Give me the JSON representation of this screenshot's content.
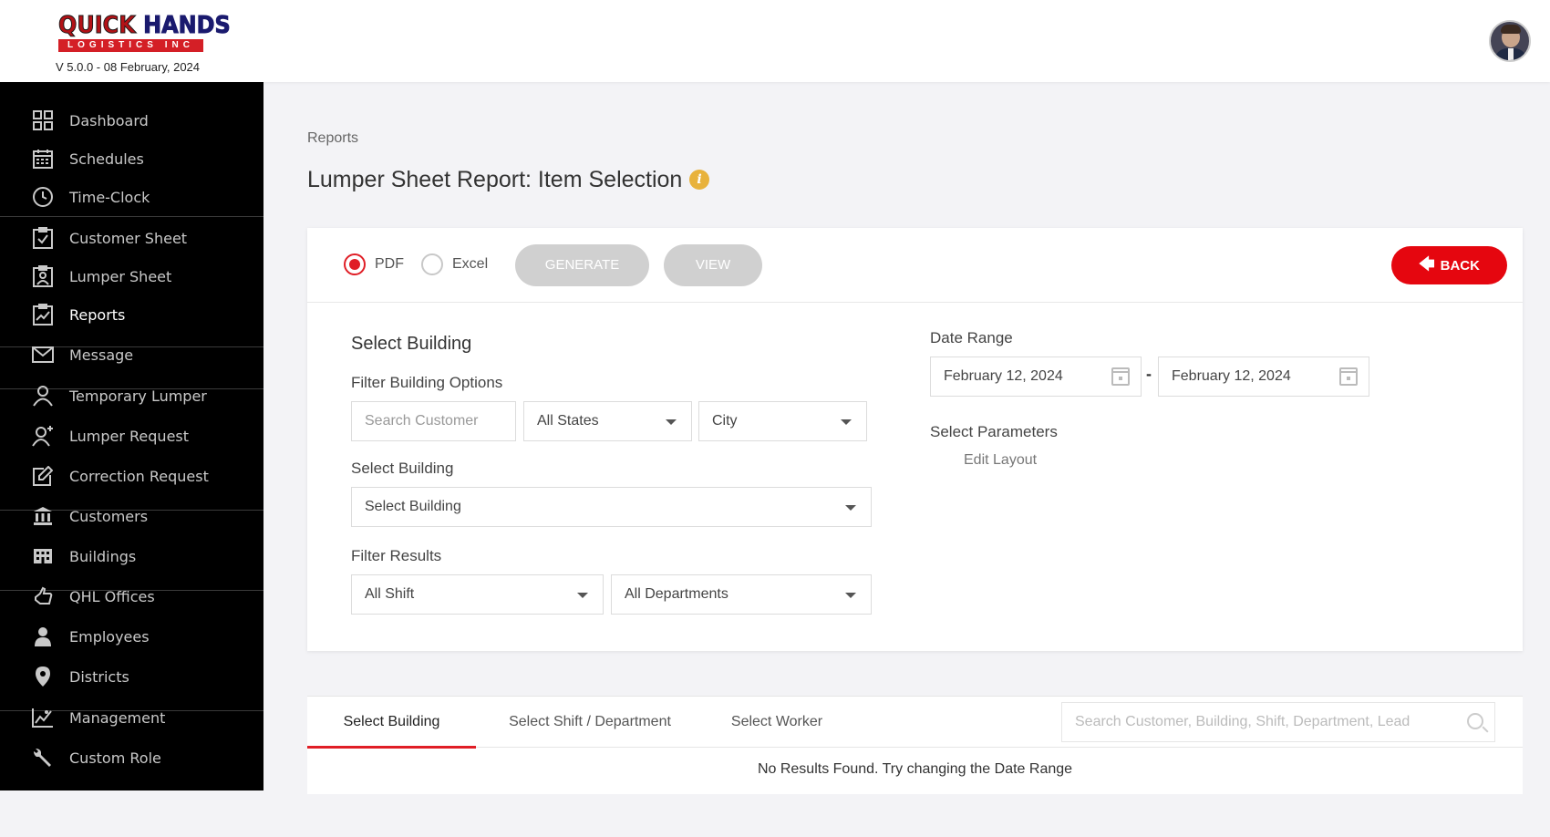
{
  "header": {
    "logo_main_1": "QUICK",
    "logo_main_2": "HANDS",
    "logo_sub": "LOGISTICS INC",
    "version": "V 5.0.0 - 08 February, 2024"
  },
  "sidebar": {
    "items": [
      {
        "label": "Dashboard",
        "icon": "dashboard-icon"
      },
      {
        "label": "Schedules",
        "icon": "calendar-icon"
      },
      {
        "label": "Time-Clock",
        "icon": "clock-icon"
      },
      {
        "label": "Customer Sheet",
        "icon": "clipboard-check-icon"
      },
      {
        "label": "Lumper Sheet",
        "icon": "clipboard-user-icon"
      },
      {
        "label": "Reports",
        "icon": "report-icon"
      },
      {
        "label": "Message",
        "icon": "envelope-icon"
      },
      {
        "label": "Temporary Lumper",
        "icon": "user-outline-icon"
      },
      {
        "label": "Lumper Request",
        "icon": "user-plus-icon"
      },
      {
        "label": "Correction Request",
        "icon": "edit-icon"
      },
      {
        "label": "Customers",
        "icon": "bank-icon"
      },
      {
        "label": "Buildings",
        "icon": "buildings-icon"
      },
      {
        "label": "QHL Offices",
        "icon": "hand-icon"
      },
      {
        "label": "Employees",
        "icon": "user-icon"
      },
      {
        "label": "Districts",
        "icon": "map-pin-icon"
      },
      {
        "label": "Management",
        "icon": "chart-icon"
      },
      {
        "label": "Custom Role",
        "icon": "wrench-icon"
      }
    ]
  },
  "breadcrumb": "Reports",
  "page_title": "Lumper Sheet Report: Item Selection",
  "info_glyph": "i",
  "toolbar": {
    "pdf_label": "PDF",
    "excel_label": "Excel",
    "generate_label": "GENERATE",
    "view_label": "VIEW",
    "back_label": "BACK",
    "back_arrow": "🡄"
  },
  "form": {
    "select_building_title": "Select Building",
    "filter_options_label": "Filter Building Options",
    "search_customer_placeholder": "Search Customer",
    "states_value": "All States",
    "city_value": "City",
    "select_building_label": "Select Building",
    "select_building_value": "Select Building",
    "filter_results_label": "Filter Results",
    "shift_value": "All Shift",
    "departments_value": "All Departments",
    "date_range_label": "Date Range",
    "date_from": "February 12, 2024",
    "date_separator": "-",
    "date_to": "February 12, 2024",
    "select_parameters_label": "Select Parameters",
    "edit_layout_label": "Edit Layout"
  },
  "tabs": {
    "items": [
      "Select Building",
      "Select Shift / Department",
      "Select Worker"
    ],
    "search_placeholder": "Search Customer, Building, Shift, Department, Lead",
    "no_results": "No Results Found. Try changing the Date Range"
  },
  "colors": {
    "accent_red": "#e5060f",
    "sidebar_bg": "#000000",
    "disabled_button": "#d0d0d0"
  }
}
